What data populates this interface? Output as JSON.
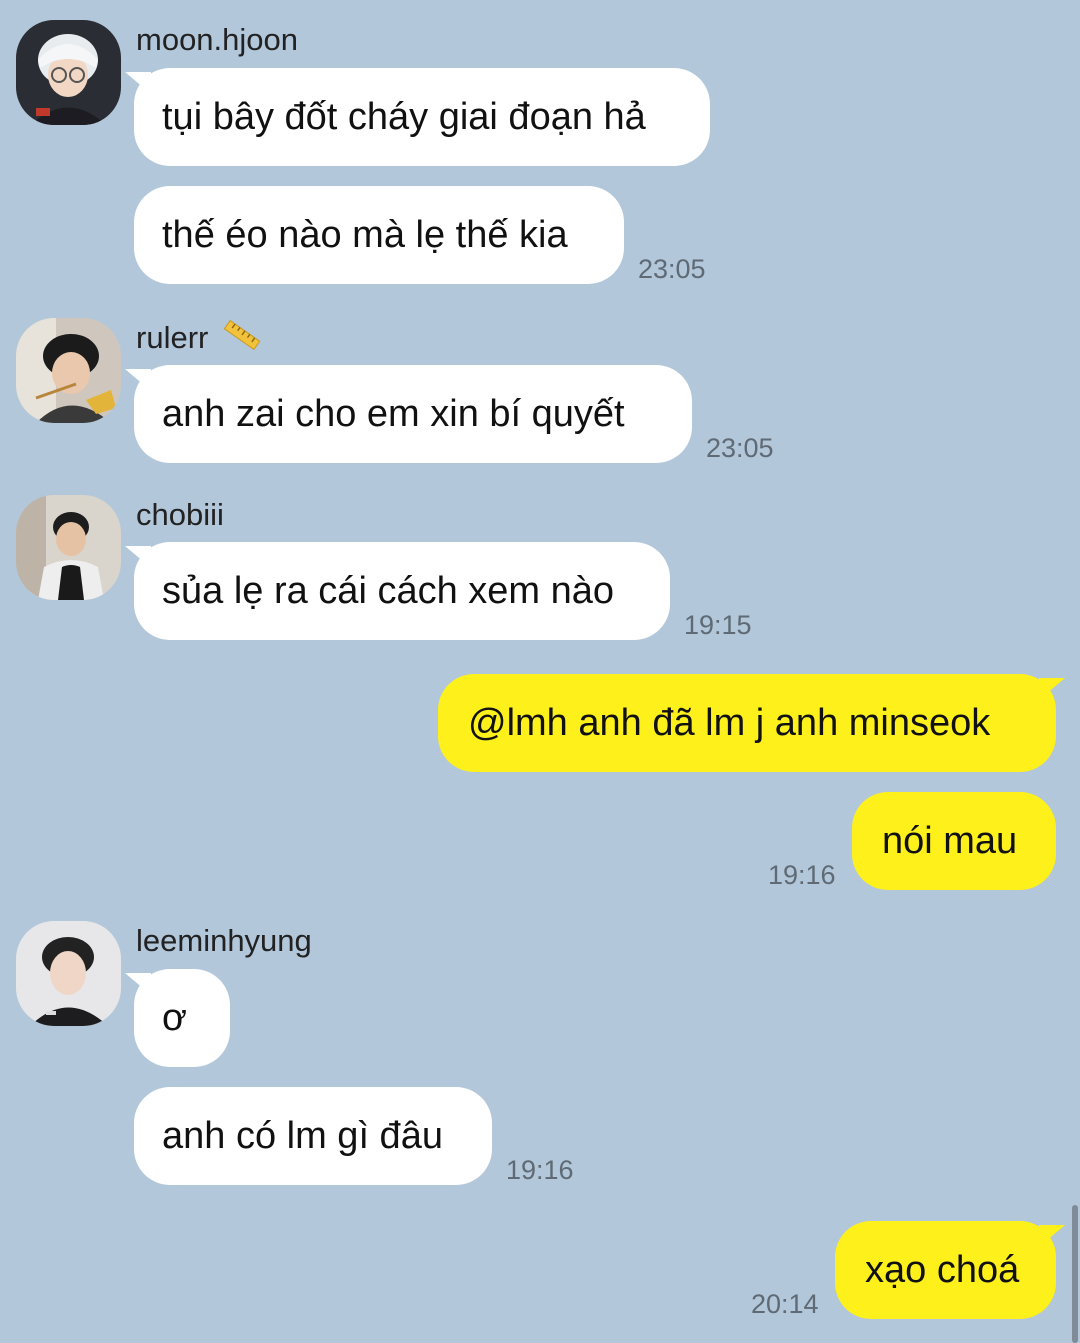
{
  "messages": [
    {
      "sender": "moon.hjoon",
      "texts": [
        "tụi bây đốt cháy giai đoạn hả",
        "thế éo nào mà lẹ thế kia"
      ],
      "time": "23:05"
    },
    {
      "sender": "rulerr",
      "sender_emoji": "ruler-icon",
      "texts": [
        "anh zai cho em xin bí quyết"
      ],
      "time": "23:05"
    },
    {
      "sender": "chobiii",
      "texts": [
        "sủa lẹ ra cái cách xem nào"
      ],
      "time": "19:15"
    },
    {
      "sender": "me",
      "texts": [
        "@lmh anh đã lm j anh minseok",
        "nói mau"
      ],
      "time": "19:16"
    },
    {
      "sender": "leeminhyung",
      "texts": [
        "ơ",
        "anh có lm gì đâu"
      ],
      "time": "19:16"
    },
    {
      "sender": "me",
      "texts": [
        "xạo choá"
      ],
      "time": "20:14"
    }
  ],
  "colors": {
    "background": "#b2c7da",
    "incoming_bubble": "#ffffff",
    "outgoing_bubble": "#fef01b",
    "timestamp": "#5f6a74"
  }
}
